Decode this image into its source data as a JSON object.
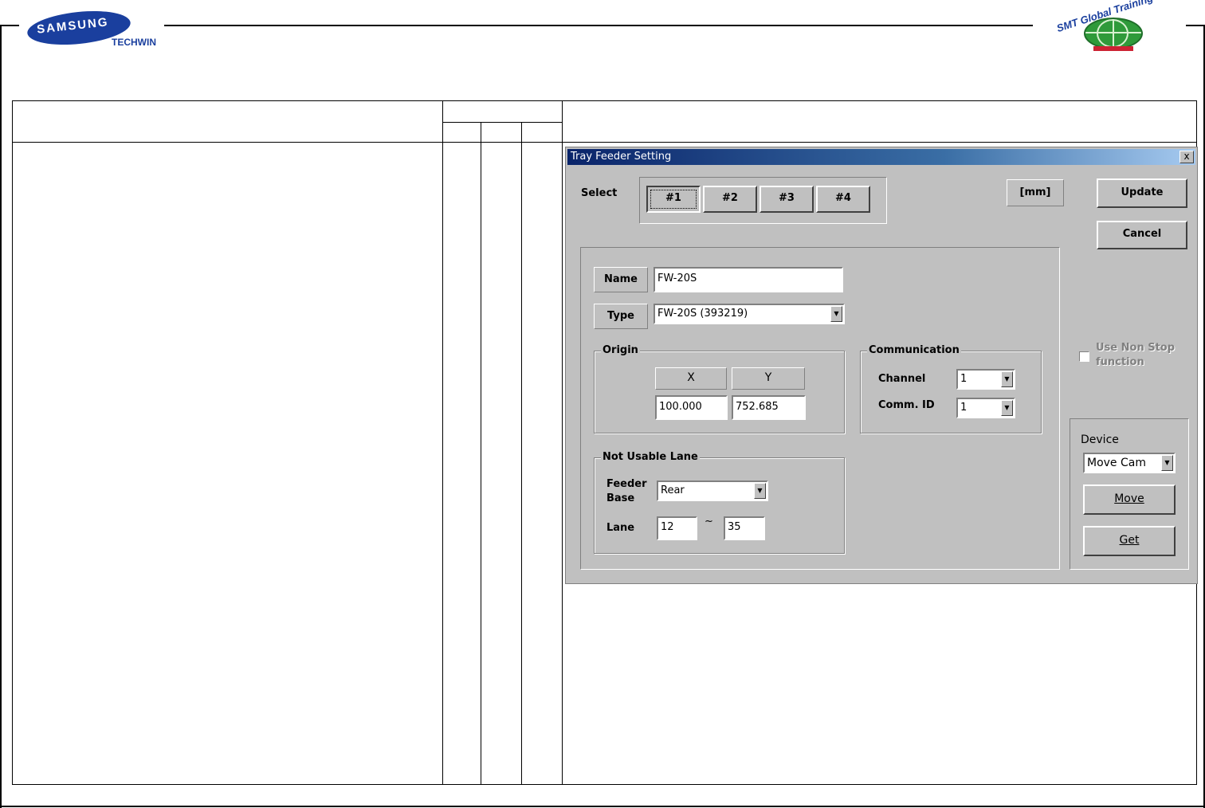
{
  "header": {
    "brand_primary": "SAMSUNG",
    "brand_secondary": "TECHWIN",
    "training_center": "SMT Global Training Center"
  },
  "dialog": {
    "title": "Tray Feeder Setting",
    "close_label": "x",
    "select_label": "Select",
    "select_buttons": [
      "#1",
      "#2",
      "#3",
      "#4"
    ],
    "selected_index": 0,
    "unit_label": "[mm]",
    "update_label": "Update",
    "cancel_label": "Cancel",
    "name_label": "Name",
    "name_value": "FW-20S",
    "type_label": "Type",
    "type_value": "FW-20S (393219)",
    "origin": {
      "title": "Origin",
      "x_header": "X",
      "y_header": "Y",
      "x_value": "100.000",
      "y_value": "752.685"
    },
    "communication": {
      "title": "Communication",
      "channel_label": "Channel",
      "channel_value": "1",
      "comm_id_label": "Comm. ID",
      "comm_id_value": "1"
    },
    "non_stop": {
      "label_line1": "Use Non Stop",
      "label_line2": "function",
      "checked": false
    },
    "not_usable_lane": {
      "title": "Not Usable Lane",
      "feeder_base_label_line1": "Feeder",
      "feeder_base_label_line2": "Base",
      "feeder_base_value": "Rear",
      "lane_label": "Lane",
      "lane_from": "12",
      "lane_sep": "~",
      "lane_to": "35"
    },
    "device": {
      "title": "Device",
      "device_value": "Move Cam",
      "move_label": "Move",
      "get_label": "Get"
    }
  }
}
